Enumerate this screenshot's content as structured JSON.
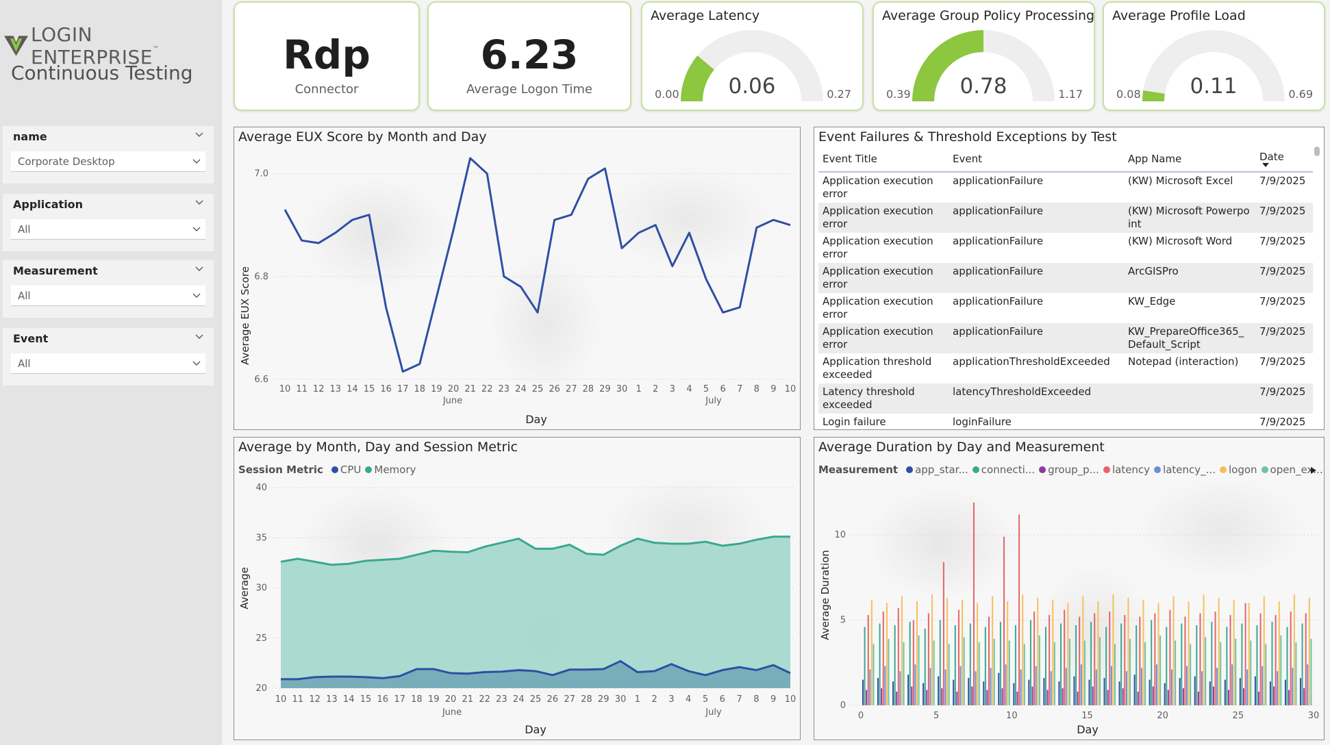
{
  "brand": {
    "logo_text": "LOGIN ENTERPRISE",
    "trademark": "™",
    "subtitle": "Continuous Testing"
  },
  "slicers": [
    {
      "label": "name",
      "value": "Corporate Desktop"
    },
    {
      "label": "Application",
      "value": "All"
    },
    {
      "label": "Measurement",
      "value": "All"
    },
    {
      "label": "Event",
      "value": "All"
    }
  ],
  "kpis": {
    "connector": {
      "value": "Rdp",
      "label": "Connector"
    },
    "logon": {
      "value": "6.23",
      "label": "Average Logon Time"
    }
  },
  "gauges": [
    {
      "title": "Average Latency",
      "min": "0.00",
      "max": "0.27",
      "value": "0.06",
      "min_num": 0.0,
      "max_num": 0.27,
      "value_num": 0.06
    },
    {
      "title": "Average Group Policy Processing",
      "min": "0.39",
      "max": "1.17",
      "value": "0.78",
      "min_num": 0.39,
      "max_num": 1.17,
      "value_num": 0.78
    },
    {
      "title": "Average Profile Load",
      "min": "0.08",
      "max": "0.69",
      "value": "0.11",
      "min_num": 0.08,
      "max_num": 0.69,
      "value_num": 0.11
    }
  ],
  "colors": {
    "accent_green": "#8dc63f",
    "gauge_track": "#eeeeee",
    "eux_line": "#2e4fa3",
    "memory": "#3aa891",
    "memory_fill": "#a7d8cf",
    "cpu": "#2e4fa3",
    "card_border": "#c8e1a3"
  },
  "eux": {
    "title": "Average EUX Score by Month and Day",
    "xlabel": "Day",
    "ylabel": "Average EUX Score",
    "month_labels": [
      "June",
      "July"
    ]
  },
  "events": {
    "title": "Event Failures & Threshold Exceptions by Test",
    "headers": [
      "Event Title",
      "Event",
      "App Name",
      "Date"
    ],
    "rows": [
      [
        "Application execution error",
        "applicationFailure",
        "(KW) Microsoft Excel",
        "7/9/2025"
      ],
      [
        "Application execution error",
        "applicationFailure",
        "(KW) Microsoft Powerpoint",
        "7/9/2025"
      ],
      [
        "Application execution error",
        "applicationFailure",
        "(KW) Microsoft Word",
        "7/9/2025"
      ],
      [
        "Application execution error",
        "applicationFailure",
        "ArcGISPro",
        "7/9/2025"
      ],
      [
        "Application execution error",
        "applicationFailure",
        "KW_Edge",
        "7/9/2025"
      ],
      [
        "Application execution error",
        "applicationFailure",
        "KW_PrepareOffice365_Default_Script",
        "7/9/2025"
      ],
      [
        "Application threshold exceeded",
        "applicationThresholdExceeded",
        "Notepad (interaction)",
        "7/9/2025"
      ],
      [
        "Latency threshold exceeded",
        "latencyThresholdExceeded",
        "",
        "7/9/2025"
      ],
      [
        "Login failure",
        "loginFailure",
        "",
        "7/9/2025"
      ]
    ]
  },
  "session": {
    "title": "Average by Month, Day and Session Metric",
    "legend_title": "Session Metric",
    "series_names": [
      "CPU",
      "Memory"
    ],
    "xlabel": "Day",
    "ylabel": "Average",
    "month_labels": [
      "June",
      "July"
    ]
  },
  "duration": {
    "title": "Average Duration by Day and Measurement",
    "legend_title": "Measurement",
    "legend_items": [
      {
        "name": "app_star...",
        "color": "#2e4fa3"
      },
      {
        "name": "connecti...",
        "color": "#3aa891"
      },
      {
        "name": "group_p...",
        "color": "#8b3a9e"
      },
      {
        "name": "latency",
        "color": "#e8616b"
      },
      {
        "name": "latency_...",
        "color": "#6b8fd6"
      },
      {
        "name": "logon",
        "color": "#f5c05a"
      },
      {
        "name": "open_ex...",
        "color": "#6cc3a0"
      }
    ],
    "xlabel": "Day",
    "ylabel": "Average Duration"
  },
  "chart_data": [
    {
      "type": "line",
      "title": "Average EUX Score by Month and Day",
      "xlabel": "Day",
      "ylabel": "Average EUX Score",
      "x": [
        "10",
        "11",
        "12",
        "13",
        "14",
        "15",
        "16",
        "17",
        "18",
        "19",
        "20",
        "21",
        "22",
        "23",
        "24",
        "25",
        "26",
        "27",
        "28",
        "29",
        "30",
        "1",
        "2",
        "3",
        "4",
        "5",
        "6",
        "7",
        "8",
        "9",
        "10"
      ],
      "ylim": [
        6.6,
        7.05
      ],
      "yticks": [
        6.6,
        6.8,
        7.0
      ],
      "values": [
        6.93,
        6.87,
        6.865,
        6.885,
        6.91,
        6.92,
        6.74,
        6.615,
        6.63,
        6.76,
        6.89,
        7.03,
        7.0,
        6.8,
        6.78,
        6.73,
        6.91,
        6.92,
        6.99,
        7.01,
        6.855,
        6.885,
        6.9,
        6.82,
        6.885,
        6.795,
        6.73,
        6.74,
        6.895,
        6.91,
        6.9
      ]
    },
    {
      "type": "area",
      "title": "Average by Month, Day and Session Metric",
      "xlabel": "Day",
      "ylabel": "Average",
      "x": [
        "10",
        "11",
        "12",
        "13",
        "14",
        "15",
        "16",
        "17",
        "18",
        "19",
        "20",
        "21",
        "22",
        "23",
        "24",
        "25",
        "26",
        "27",
        "28",
        "29",
        "30",
        "1",
        "2",
        "3",
        "4",
        "5",
        "6",
        "7",
        "8",
        "9",
        "10"
      ],
      "ylim": [
        20,
        40
      ],
      "yticks": [
        20,
        25,
        30,
        35,
        40
      ],
      "series": [
        {
          "name": "CPU",
          "values": [
            20.9,
            20.9,
            21.1,
            21.15,
            21.15,
            21.1,
            21.0,
            21.2,
            21.9,
            21.9,
            21.5,
            21.45,
            21.6,
            21.65,
            21.8,
            21.7,
            21.3,
            21.85,
            21.85,
            21.9,
            22.7,
            21.6,
            21.7,
            22.4,
            21.7,
            21.3,
            21.8,
            22.1,
            21.8,
            22.3,
            21.5
          ]
        },
        {
          "name": "Memory",
          "values": [
            32.6,
            32.9,
            32.6,
            32.3,
            32.4,
            32.7,
            32.8,
            32.9,
            33.3,
            33.7,
            33.6,
            33.55,
            34.1,
            34.5,
            34.9,
            33.9,
            33.9,
            34.3,
            33.4,
            33.3,
            34.2,
            34.9,
            34.5,
            34.4,
            34.4,
            34.6,
            34.2,
            34.4,
            34.8,
            35.1,
            35.1
          ]
        }
      ]
    },
    {
      "type": "bar",
      "title": "Average Duration by Day and Measurement",
      "xlabel": "Day",
      "ylabel": "Average Duration",
      "xlim": [
        0,
        30
      ],
      "xticks": [
        0,
        5,
        10,
        15,
        20,
        25,
        30
      ],
      "ylim": [
        0,
        12.5
      ],
      "yticks": [
        0,
        5,
        10
      ],
      "series": [
        {
          "name": "app_star...",
          "color": "#2e4fa3",
          "peak": [
            1.5,
            1.6,
            1.4,
            1.8,
            1.3,
            1.7,
            1.5,
            1.6,
            1.4,
            1.9,
            1.3,
            1.5,
            1.6,
            1.4,
            1.7,
            1.5,
            1.6,
            1.4,
            1.8,
            1.5,
            1.3,
            1.6,
            1.7,
            1.4,
            1.5,
            1.6,
            1.7,
            1.4,
            1.5,
            1.6
          ]
        },
        {
          "name": "connecti...",
          "color": "#3aa891",
          "peak": [
            4.6,
            4.8,
            4.7,
            4.9,
            4.5,
            5.0,
            4.7,
            4.8,
            4.6,
            4.9,
            4.7,
            5.0,
            4.6,
            4.8,
            4.7,
            4.9,
            4.6,
            4.8,
            4.7,
            5.0,
            4.6,
            4.8,
            4.7,
            4.9,
            4.6,
            4.8,
            4.7,
            4.9,
            4.6,
            4.8
          ]
        },
        {
          "name": "group_p...",
          "color": "#8b3a9e",
          "peak": [
            0.9,
            1.0,
            0.8,
            1.1,
            0.9,
            1.0,
            0.8,
            1.1,
            0.9,
            1.0,
            0.8,
            1.1,
            0.9,
            1.0,
            0.8,
            1.1,
            0.9,
            1.0,
            0.8,
            1.1,
            0.9,
            1.0,
            0.8,
            1.1,
            0.9,
            1.0,
            0.8,
            1.1,
            0.9,
            1.0
          ]
        },
        {
          "name": "latency",
          "color": "#e8616b",
          "peak": [
            5.3,
            5.5,
            5.7,
            5.0,
            5.4,
            8.4,
            5.6,
            11.9,
            5.2,
            9.9,
            11.2,
            5.5,
            5.3,
            5.6,
            5.2,
            5.4,
            5.5,
            5.3,
            5.2,
            5.4,
            5.6,
            5.2,
            5.4,
            5.5,
            5.3,
            6.0,
            5.4,
            5.3,
            5.5,
            5.4
          ]
        },
        {
          "name": "latency_...",
          "color": "#6b8fd6",
          "peak": [
            2.1,
            2.3,
            2.0,
            2.4,
            2.2,
            2.1,
            2.3,
            2.0,
            2.2,
            2.4,
            2.1,
            2.3,
            2.0,
            2.2,
            2.4,
            2.1,
            2.3,
            2.0,
            2.2,
            2.4,
            2.1,
            2.3,
            2.0,
            2.2,
            2.4,
            2.1,
            2.3,
            2.0,
            2.2,
            2.4
          ]
        },
        {
          "name": "logon",
          "color": "#f5c05a",
          "peak": [
            6.2,
            6.0,
            6.4,
            6.1,
            6.5,
            6.3,
            6.2,
            6.0,
            6.4,
            6.1,
            6.5,
            6.3,
            6.2,
            6.0,
            6.4,
            6.1,
            6.5,
            6.3,
            6.2,
            6.0,
            6.4,
            6.1,
            6.5,
            6.3,
            6.2,
            6.0,
            6.4,
            6.1,
            6.5,
            6.3
          ]
        },
        {
          "name": "open_ex...",
          "color": "#6cc3a0",
          "peak": [
            3.6,
            3.9,
            3.7,
            4.1,
            3.8,
            3.6,
            4.0,
            3.7,
            3.9,
            3.8,
            3.6,
            4.1,
            3.7,
            3.9,
            3.8,
            4.0,
            3.6,
            3.9,
            3.7,
            4.1,
            3.8,
            3.6,
            4.0,
            3.7,
            3.9,
            3.8,
            3.6,
            4.1,
            3.7,
            3.9
          ]
        }
      ]
    }
  ]
}
